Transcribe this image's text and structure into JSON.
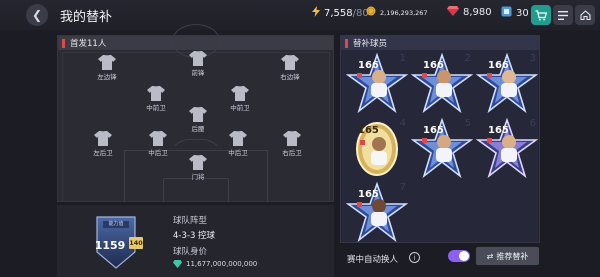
{
  "header": {
    "back_icon": "chevron-left-icon",
    "title": "我的替补"
  },
  "currencies": {
    "energy": {
      "icon": "lightning-icon",
      "value": "7,558",
      "max": "/80"
    },
    "coins": {
      "icon": "coin-icon",
      "value": "2,196,293,267"
    },
    "gems": {
      "icon": "ruby-icon",
      "value": "8,980"
    },
    "tickets": {
      "icon": "ticket-icon",
      "value": "30"
    }
  },
  "toolbar": {
    "shop_icon": "cart-icon",
    "menu_icon": "list-icon",
    "home_icon": "home-icon"
  },
  "starting": {
    "title": "首发11人",
    "positions": [
      {
        "label": "左边锋"
      },
      {
        "label": "前锋"
      },
      {
        "label": "右边锋"
      },
      {
        "label": "中前卫"
      },
      {
        "label": "中前卫"
      },
      {
        "label": "后腰"
      },
      {
        "label": "左后卫"
      },
      {
        "label": "中后卫"
      },
      {
        "label": "中后卫"
      },
      {
        "label": "右后卫"
      },
      {
        "label": "门将"
      }
    ]
  },
  "team": {
    "ovr_label": "能力值",
    "ovr_value": "1159",
    "ovr_chip": "140",
    "formation_label": "球队阵型",
    "formation_value": "4-3-3 控球",
    "value_label": "球队身价",
    "value_amount": "11,677,000,000,000"
  },
  "subs": {
    "title": "替补球员",
    "cards": [
      {
        "rating": "166",
        "type": "blue"
      },
      {
        "rating": "166",
        "type": "blue"
      },
      {
        "rating": "166",
        "type": "blue"
      },
      {
        "rating": "165",
        "type": "gold"
      },
      {
        "rating": "165",
        "type": "blue"
      },
      {
        "rating": "165",
        "type": "blue"
      },
      {
        "rating": "165",
        "type": "blue"
      }
    ]
  },
  "controls": {
    "auto_sub_label": "赛中自动换人",
    "auto_sub_on": true,
    "recommend_label": "推荐替补"
  },
  "colors": {
    "accent_red": "#e24848",
    "toggle_purple": "#8a61f0",
    "shop_teal": "#1f9e8f",
    "gold_chip": "#e8c86a"
  }
}
